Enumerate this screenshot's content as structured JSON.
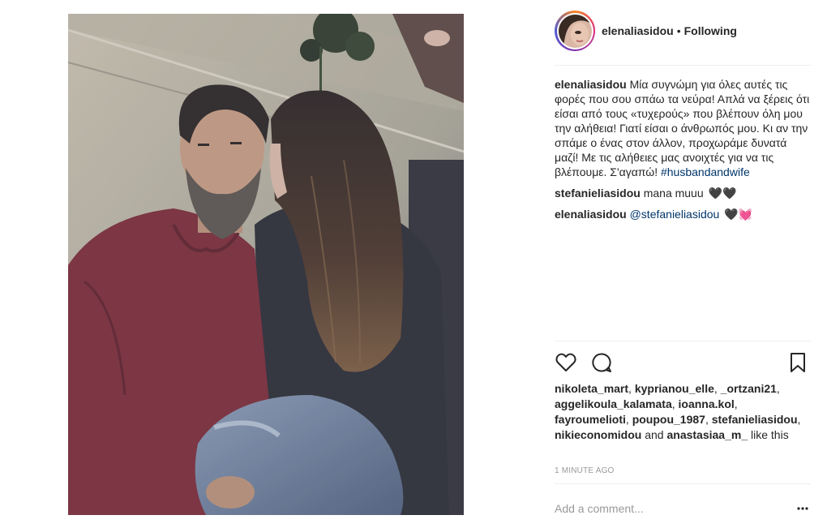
{
  "post": {
    "username": "elenaliasidou",
    "separator": "•",
    "follow_status": "Following"
  },
  "caption": {
    "user": "elenaliasidou",
    "text": "Μία συγνώμη για όλες αυτές τις φορές που σου σπάω τα νεύρα! Απλά να ξέρεις ότι είσαι από τους «τυχερούς» που βλέπουν όλη μου την αλήθεια! Γιατί είσαι ο άνθρωπός μου. Κι αν την σπάμε ο ένας στον άλλον, προχωράμε δυνατά μαζί! Με τις αλήθειες μας ανοιχτές για να τις βλέπουμε. Σ'αγαπώ!",
    "hashtag": "#husbandandwife"
  },
  "comments": [
    {
      "user": "stefanieliasidou",
      "text": "mana muuu",
      "emoji": "🖤🖤"
    },
    {
      "user": "elenaliasidou",
      "mention": "@stefanieliasidou",
      "emoji": "🖤💓"
    }
  ],
  "likes": {
    "users": [
      "nikoleta_mart",
      "kyprianou_elle",
      "_ortzani21",
      "aggelikoula_kalamata",
      "ioanna.kol",
      "fayroumelioti",
      "poupou_1987",
      "stefanieliasidou",
      "nikieconomidou",
      "anastasiaa_m_"
    ],
    "sep": ", ",
    "and": " and ",
    "suffix": " like this"
  },
  "timestamp": "1 MINUTE AGO",
  "add_comment": {
    "placeholder": "Add a comment..."
  },
  "icons": {
    "like": "heart-icon",
    "comment": "speech-bubble-icon",
    "save": "bookmark-icon",
    "more": "more-options-icon"
  },
  "colors": {
    "link": "#003569",
    "muted": "#999999",
    "divider": "#efefef"
  }
}
